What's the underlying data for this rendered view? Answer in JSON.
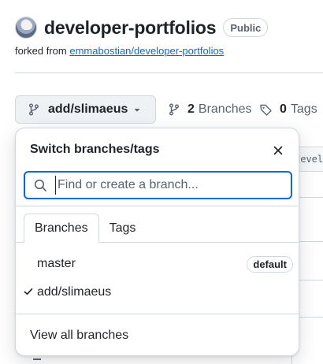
{
  "repo": {
    "name": "developer-portfolios",
    "visibility": "Public",
    "fork_prefix": "forked from ",
    "fork_source": "emmabostian/developer-portfolios"
  },
  "branch_bar": {
    "current_branch": "add/slimaeus",
    "branches_count": "2",
    "branches_label": "Branches",
    "tags_count": "0",
    "tags_label": "Tags"
  },
  "background": {
    "code_fragment": "develo"
  },
  "popover": {
    "title": "Switch branches/tags",
    "search_placeholder": "Find or create a branch...",
    "tabs": [
      {
        "label": "Branches",
        "selected": true
      },
      {
        "label": "Tags",
        "selected": false
      }
    ],
    "branches": [
      {
        "name": "master",
        "badge": "default",
        "checked": false
      },
      {
        "name": "add/slimaeus",
        "badge": "",
        "checked": true
      }
    ],
    "view_all_label": "View all branches"
  },
  "colors": {
    "accent_focus": "#0969da",
    "link": "#0969da",
    "text_primary": "#1f2328",
    "text_muted": "#59636e",
    "border": "#d1d9e0",
    "button_bg": "#eff2f5"
  }
}
